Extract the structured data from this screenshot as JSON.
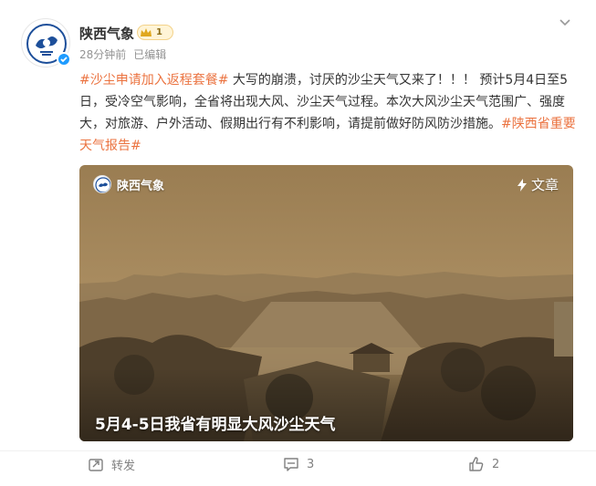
{
  "header": {
    "username": "陕西气象",
    "vip_level": "1",
    "time": "28分钟前",
    "edited": "已编辑"
  },
  "post": {
    "tag_1": "#沙尘申请加入返程套餐#",
    "text_1": " 大写的崩溃，讨厌的沙尘天气又来了！！！ 预计5月4日至5日，受冷空气影响，全省将出现大风、沙尘天气过程。本次大风沙尘天气范围广、强度大，对旅游、户外活动、假期出行有不利影响，请提前做好防风防沙措施。",
    "tag_2": "#陕西省重要天气报告#"
  },
  "media": {
    "source": "陕西气象",
    "article_label": "文章",
    "caption": "5月4-5日我省有明显大风沙尘天气"
  },
  "actions": {
    "repost_label": "转发",
    "comment_count": "3",
    "like_count": "2"
  },
  "colors": {
    "tag": "#eb7340",
    "verified": "#1e9bff",
    "dust_sky": "#a4865a"
  },
  "icons": [
    "chevron-down-icon",
    "verified-icon",
    "vip-crown-icon",
    "lightning-icon",
    "repost-icon",
    "comment-icon",
    "like-icon"
  ]
}
